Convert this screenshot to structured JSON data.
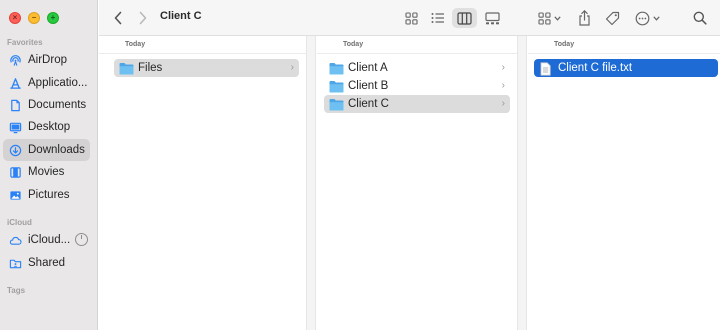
{
  "toolbar": {
    "title": "Client C",
    "back_icon": "chevron-left-icon",
    "forward_icon": "chevron-right-icon",
    "view_icons": [
      "icon-view-icon",
      "list-view-icon",
      "column-view-icon",
      "gallery-view-icon"
    ],
    "group_icon": "group-icon",
    "share_icon": "share-icon",
    "tag_icon": "tag-icon",
    "more_icon": "ellipsis-icon",
    "search_icon": "search-icon"
  },
  "sidebar": {
    "favorites_label": "Favorites",
    "favorites": [
      {
        "label": "AirDrop",
        "icon": "airdrop-icon"
      },
      {
        "label": "Applicatio...",
        "icon": "applications-icon"
      },
      {
        "label": "Documents",
        "icon": "document-icon"
      },
      {
        "label": "Desktop",
        "icon": "desktop-icon"
      },
      {
        "label": "Downloads",
        "icon": "downloads-icon",
        "active": true
      },
      {
        "label": "Movies",
        "icon": "movies-icon"
      },
      {
        "label": "Pictures",
        "icon": "pictures-icon"
      }
    ],
    "icloud_label": "iCloud",
    "icloud": [
      {
        "label": "iCloud...",
        "icon": "cloud-icon"
      },
      {
        "label": "Shared",
        "icon": "shared-folder-icon"
      }
    ],
    "tags_label": "Tags"
  },
  "columns": [
    {
      "header": "Today",
      "items": [
        {
          "label": "Files",
          "type": "folder",
          "selected": "grey"
        }
      ]
    },
    {
      "header": "Today",
      "items": [
        {
          "label": "Client A",
          "type": "folder"
        },
        {
          "label": "Client B",
          "type": "folder"
        },
        {
          "label": "Client C",
          "type": "folder",
          "selected": "grey"
        }
      ]
    },
    {
      "header": "Today",
      "items": [
        {
          "label": "Client C file.txt",
          "type": "text-file",
          "selected": "blue"
        }
      ]
    }
  ],
  "colors": {
    "selection_blue": "#1e6bd6",
    "selection_grey": "#dcdcdc",
    "folder_blue": "#5fb3ec",
    "sidebar_icon_blue": "#2b82f6"
  }
}
